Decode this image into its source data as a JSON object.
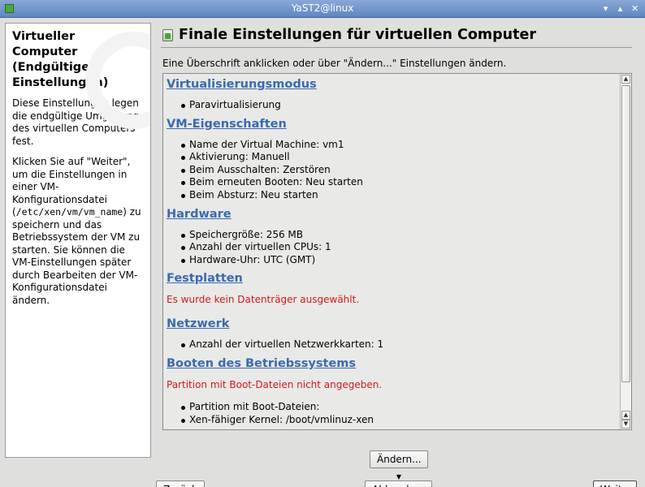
{
  "window": {
    "title": "YaST2@linux",
    "buttons": [
      "minimize",
      "maximize",
      "close"
    ]
  },
  "help": {
    "title": "Virtueller Computer (Endgültige Einstellungen)",
    "paragraph1": "Diese Einstellungen legen die endgültige Umgebung des virtuellen Computers fest.",
    "paragraph2_a": "Klicken Sie auf \"Weiter\", um die Einstellungen in einer VM-Konfigurationsdatei (",
    "paragraph2_code": "/etc/xen/vm/vm_name",
    "paragraph2_b": ") zu speichern und das Betriebssystem der VM zu starten. Sie können die VM-Einstellungen später durch Bearbeiten der VM-Konfigurationsdatei ändern."
  },
  "dialog": {
    "title": "Finale Einstellungen für virtuellen Computer",
    "instruction": "Eine Überschrift anklicken oder über \"Ändern...\" Einstellungen ändern."
  },
  "summary": {
    "sections": [
      {
        "heading": "Virtualisierungsmodus",
        "items": [
          "Paravirtualisierung"
        ]
      },
      {
        "heading": "VM-Eigenschaften",
        "items": [
          "Name der Virtual Machine: vm1",
          "Aktivierung: Manuell",
          "Beim Ausschalten: Zerstören",
          "Beim erneuten Booten: Neu starten",
          "Beim Absturz: Neu starten"
        ]
      },
      {
        "heading": "Hardware",
        "items": [
          "Speichergröße: 256 MB",
          "Anzahl der virtuellen CPUs: 1",
          "Hardware-Uhr: UTC (GMT)"
        ]
      },
      {
        "heading": "Festplatten",
        "error": "Es wurde kein Datenträger ausgewählt."
      },
      {
        "heading": "Netzwerk",
        "items": [
          "Anzahl der virtuellen Netzwerkkarten: 1"
        ]
      },
      {
        "heading": "Booten des Betriebssystems",
        "error": "Partition mit Boot-Dateien nicht angegeben.",
        "items": [
          "Partition mit Boot-Dateien:",
          "Xen-fähiger Kernel: /boot/vmlinuz-xen"
        ]
      }
    ]
  },
  "buttons": {
    "change": "Ändern...",
    "back": "Zurück",
    "abort": "Abbrechen",
    "next": "Weiter"
  },
  "colors": {
    "heading_link": "#3a6ab0",
    "error": "#d11a1a",
    "titlebar": "#6f93c9"
  }
}
